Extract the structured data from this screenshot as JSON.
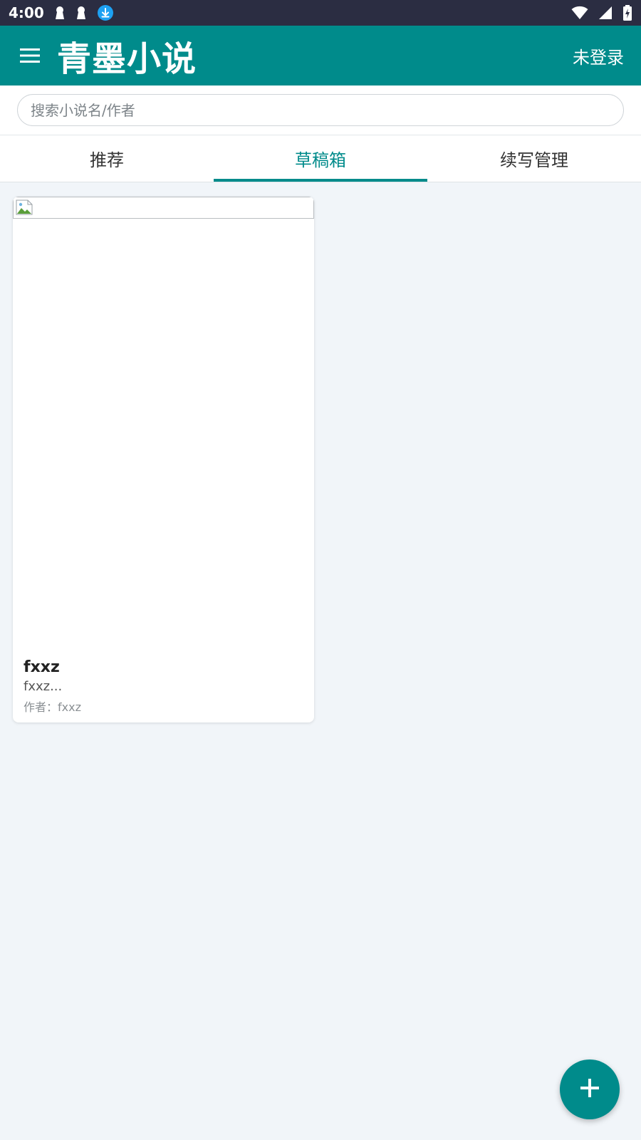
{
  "status_bar": {
    "time": "4:00",
    "left_icons": [
      "keyhole-icon",
      "keyhole-icon",
      "download-icon"
    ],
    "right_icons": [
      "wifi-icon",
      "signal-icon",
      "battery-charging-icon"
    ]
  },
  "app_bar": {
    "title": "青墨小说",
    "login_label": "未登录",
    "menu_icon": "hamburger-menu-icon"
  },
  "search": {
    "placeholder": "搜索小说名/作者",
    "value": ""
  },
  "tabs": [
    {
      "label": "推荐",
      "active": false
    },
    {
      "label": "草稿箱",
      "active": true
    },
    {
      "label": "续写管理",
      "active": false
    }
  ],
  "novels": [
    {
      "title": "fxxz",
      "description": "fxxz...",
      "author": "作者：fxxz",
      "cover_icon": "broken-image-icon"
    }
  ],
  "fab": {
    "icon": "plus-icon"
  },
  "colors": {
    "primary": "#008b8b",
    "status_bar": "#2b2d42",
    "background": "#f1f5f9"
  }
}
